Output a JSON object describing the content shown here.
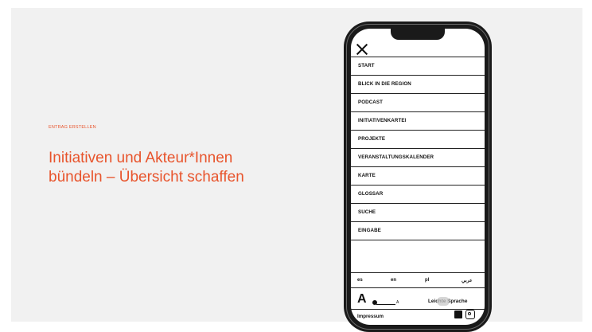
{
  "slide": {
    "kicker": "ENTRAG ERSTELLEN",
    "headline_line1": "Initiativen und Akteur*Innen",
    "headline_line2": "bündeln – Übersicht schaffen"
  },
  "phone": {
    "menu": [
      {
        "label": "START"
      },
      {
        "label": "BLICK IN DIE REGION"
      },
      {
        "label": "PODCAST"
      },
      {
        "label": "INITIATIVENKARTEI"
      },
      {
        "label": "PROJEKTE"
      },
      {
        "label": "VERANSTALTUNGSKALENDER"
      },
      {
        "label": "KARTE"
      },
      {
        "label": "GLOSSAR"
      },
      {
        "label": "SUCHE"
      },
      {
        "label": "EINGABE"
      }
    ],
    "languages": [
      "es",
      "en",
      "pl",
      "عربي"
    ],
    "font_size": {
      "large_label": "A",
      "small_label": "A"
    },
    "easy_language_label": "Leichte Sprache",
    "footer": {
      "impressum": "Impressum"
    }
  },
  "icons": [
    "close-icon",
    "facebook-icon",
    "instagram-icon"
  ],
  "colors": {
    "accent": "#e8542c",
    "phone_body": "#1a1a1a",
    "background": "#f1f1f1"
  }
}
